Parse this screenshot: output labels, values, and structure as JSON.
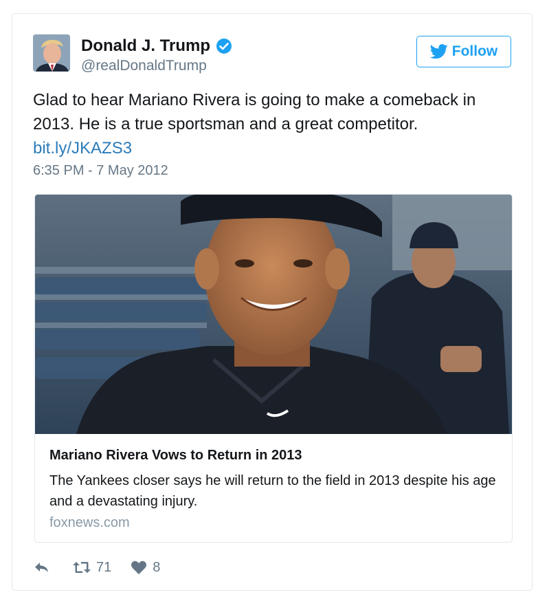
{
  "author": {
    "display_name": "Donald J. Trump",
    "handle": "@realDonaldTrump",
    "verified": true
  },
  "follow_button": {
    "label": "Follow"
  },
  "tweet": {
    "text": "Glad to hear Mariano Rivera is going to make a comeback in 2013. He is a true sportsman and a great competitor.",
    "link": "bit.ly/JKAZS3",
    "timestamp": "6:35 PM - 7 May 2012"
  },
  "card": {
    "title": "Mariano Rivera Vows to Return in 2013",
    "description": "The Yankees closer says he will return to the field in 2013 despite his age and a devastating injury.",
    "domain": "foxnews.com"
  },
  "actions": {
    "retweet_count": "71",
    "like_count": "8"
  },
  "colors": {
    "accent": "#1da1f2",
    "link": "#2b7bb9",
    "secondary_text": "#657786",
    "border": "#e1e8ed"
  },
  "icons": [
    "verified-badge-icon",
    "twitter-bird-icon",
    "reply-icon",
    "retweet-icon",
    "heart-icon"
  ]
}
